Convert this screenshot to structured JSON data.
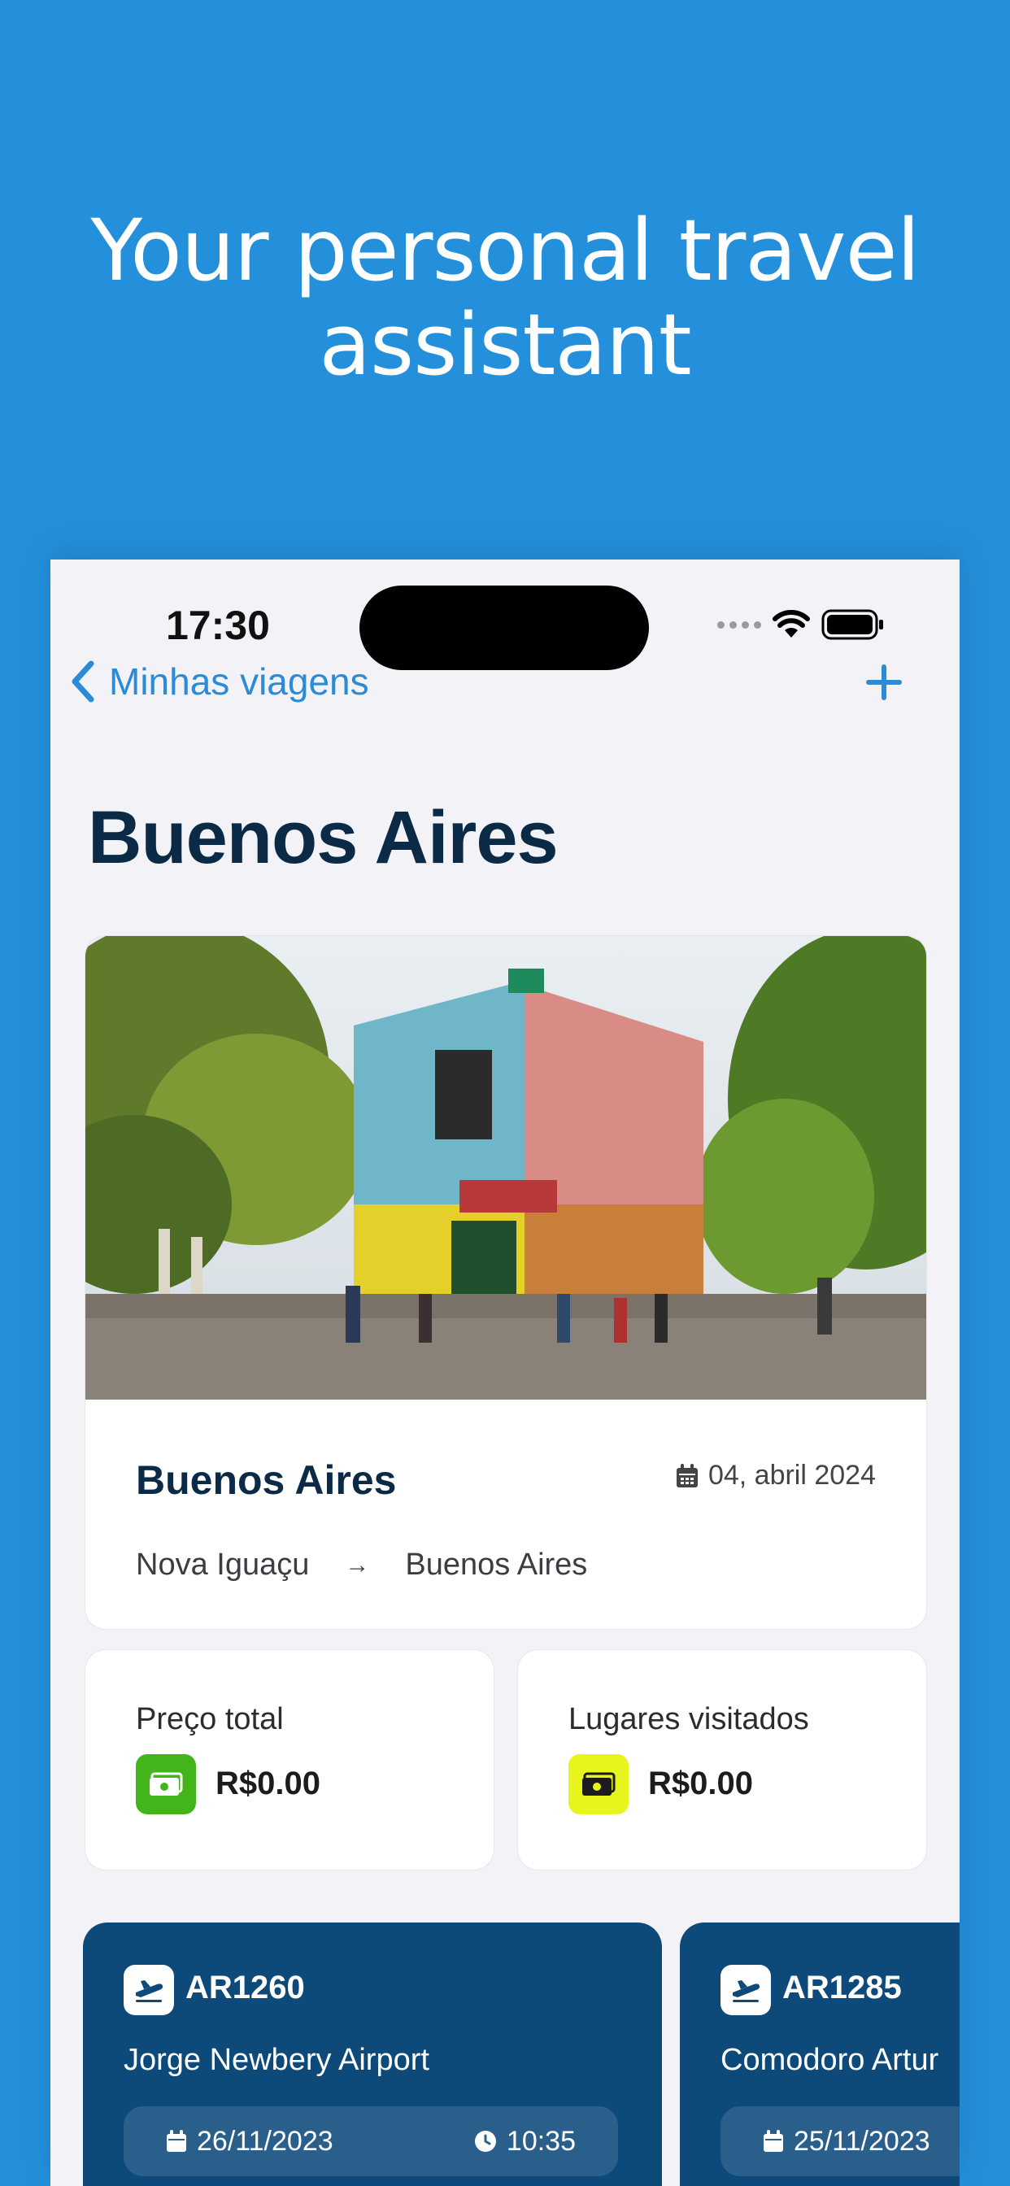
{
  "hero": {
    "headline_line1": "Your personal travel",
    "headline_line2": "assistant"
  },
  "status_bar": {
    "time": "17:30"
  },
  "nav": {
    "back_label": "Minhas viagens",
    "add_icon": "plus-icon"
  },
  "page": {
    "title": "Buenos Aires"
  },
  "trip_card": {
    "name": "Buenos Aires",
    "date": "04, abril 2024",
    "origin": "Nova Iguaçu",
    "arrow": "→",
    "destination": "Buenos Aires"
  },
  "stats": [
    {
      "label": "Preço total",
      "value": "R$0.00",
      "icon": "money-icon",
      "color": "#43b51b"
    },
    {
      "label": "Lugares visitados",
      "value": "R$0.00",
      "icon": "money-icon",
      "color": "#e8f51c"
    }
  ],
  "flights": [
    {
      "code": "AR1260",
      "airport": "Jorge Newbery Airport",
      "date": "26/11/2023",
      "time": "10:35"
    },
    {
      "code": "AR1285",
      "airport": "Comodoro Artur",
      "date": "25/11/2023",
      "time": ""
    }
  ],
  "colors": {
    "background": "#2490dc",
    "accent": "#2b8bd6",
    "title": "#0b2a45",
    "flight_card": "#0d4a7a"
  }
}
